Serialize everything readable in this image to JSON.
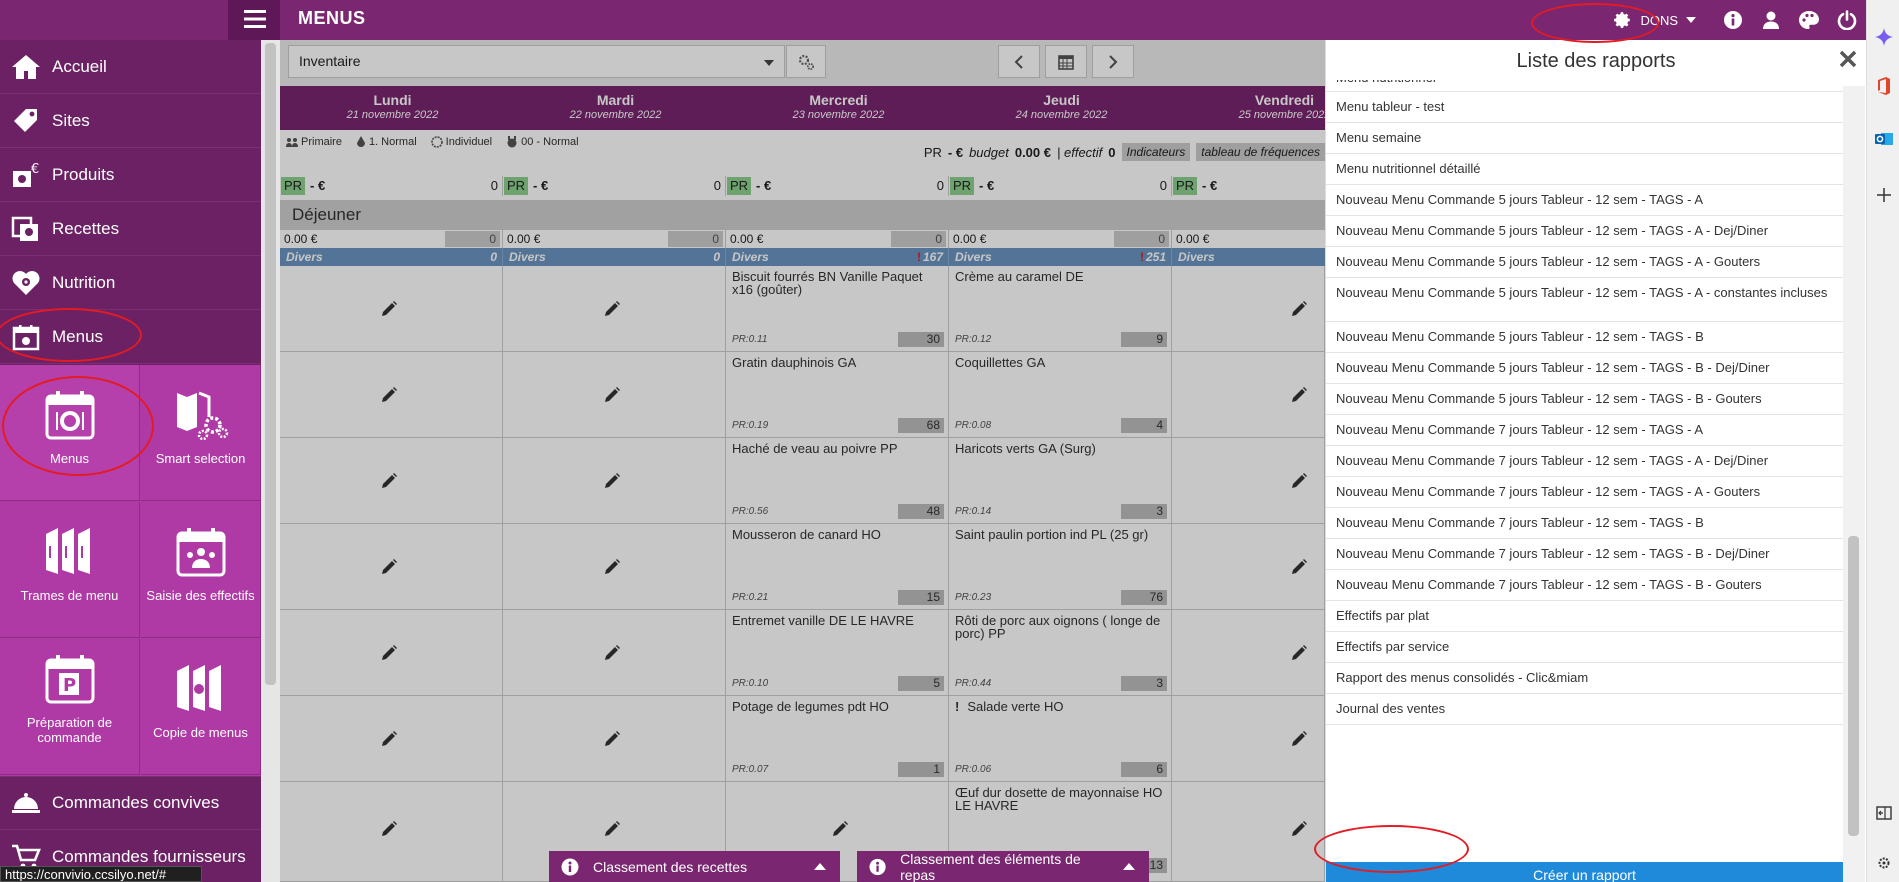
{
  "app": {
    "title": "MENUS"
  },
  "topbar": {
    "dons_label": "DONS"
  },
  "sidebar": {
    "items": [
      {
        "label": "Accueil",
        "icon": "home-icon"
      },
      {
        "label": "Sites",
        "icon": "tag-icon"
      },
      {
        "label": "Produits",
        "icon": "products-icon"
      },
      {
        "label": "Recettes",
        "icon": "recipes-icon"
      },
      {
        "label": "Nutrition",
        "icon": "nutrition-icon"
      },
      {
        "label": "Menus",
        "icon": "calendar-icon"
      }
    ],
    "tiles": [
      {
        "label": "Menus"
      },
      {
        "label": "Smart selection"
      },
      {
        "label": "Trames de menu"
      },
      {
        "label": "Saisie des effectifs"
      },
      {
        "label": "Préparation de commande"
      },
      {
        "label": "Copie de menus"
      }
    ],
    "bottom_items": [
      {
        "label": "Commandes convives"
      },
      {
        "label": "Commandes fournisseurs"
      }
    ]
  },
  "status_url": "https://convivio.ccsilyo.net/#",
  "toolbar": {
    "select_value": "Inventaire"
  },
  "days": [
    {
      "name": "Lundi",
      "date": "21 novembre 2022"
    },
    {
      "name": "Mardi",
      "date": "22 novembre 2022"
    },
    {
      "name": "Mercredi",
      "date": "23 novembre 2022"
    },
    {
      "name": "Jeudi",
      "date": "24 novembre 2022"
    },
    {
      "name": "Vendredi",
      "date": "25 novembre 2022"
    }
  ],
  "pills": [
    "Primaire",
    "1. Normal",
    "Individuel",
    "00 - Normal"
  ],
  "summary": {
    "pr_label": "PR",
    "pr_value": "- €",
    "budget_label": "budget",
    "budget_value": "0.00 €",
    "effectif_label": "| effectif",
    "effectif_value": "0",
    "btn_indicateurs": "Indicateurs",
    "btn_frequences": "tableau de fréquences"
  },
  "pr_row": [
    {
      "label": "PR",
      "euro": "- €",
      "value": "0"
    },
    {
      "label": "PR",
      "euro": "- €",
      "value": "0"
    },
    {
      "label": "PR",
      "euro": "- €",
      "value": "0"
    },
    {
      "label": "PR",
      "euro": "- €",
      "value": "0"
    },
    {
      "label": "PR",
      "euro": "- €",
      "value": ""
    }
  ],
  "section_title": "Déjeuner",
  "amount_row": [
    {
      "amount": "0.00 €",
      "value": "0"
    },
    {
      "amount": "0.00 €",
      "value": "0"
    },
    {
      "amount": "0.00 €",
      "value": "0"
    },
    {
      "amount": "0.00 €",
      "value": "0"
    },
    {
      "amount": "0.00 €",
      "value": ""
    }
  ],
  "divers_row": [
    {
      "label": "Divers",
      "value": "0",
      "alert": ""
    },
    {
      "label": "Divers",
      "value": "0",
      "alert": ""
    },
    {
      "label": "Divers",
      "value": "167",
      "alert": "!"
    },
    {
      "label": "Divers",
      "value": "251",
      "alert": "!"
    },
    {
      "label": "Divers",
      "value": "",
      "alert": ""
    }
  ],
  "dishes": {
    "mercredi": [
      {
        "name": "Biscuit fourrés BN Vanille Paquet x16 (goûter)",
        "pr": "PR:0.11",
        "qty": "30"
      },
      {
        "name": "Gratin dauphinois GA",
        "pr": "PR:0.19",
        "qty": "68"
      },
      {
        "name": "Haché de veau au poivre PP",
        "pr": "PR:0.56",
        "qty": "48"
      },
      {
        "name": "Mousseron de canard HO",
        "pr": "PR:0.21",
        "qty": "15"
      },
      {
        "name": "Entremet vanille DE LE HAVRE",
        "pr": "PR:0.10",
        "qty": "5"
      },
      {
        "name": "Potage de legumes pdt HO",
        "pr": "PR:0.07",
        "qty": "1"
      }
    ],
    "jeudi": [
      {
        "name": "Crème au caramel DE",
        "pr": "PR:0.12",
        "qty": "9"
      },
      {
        "name": "Coquillettes GA",
        "pr": "PR:0.08",
        "qty": "4"
      },
      {
        "name": "Haricots verts GA (Surg)",
        "pr": "PR:0.14",
        "qty": "3"
      },
      {
        "name": "Saint paulin portion ind PL (25 gr)",
        "pr": "PR:0.23",
        "qty": "76"
      },
      {
        "name": "Rôti de porc aux oignons ( longe de porc) PP",
        "pr": "PR:0.44",
        "qty": "3"
      },
      {
        "name": "Salade verte HO",
        "pr": "PR:0.06",
        "qty": "6",
        "alert": "!"
      },
      {
        "name": "Œuf dur dosette de mayonnaise HO LE HAVRE",
        "pr": "",
        "qty": "13"
      }
    ]
  },
  "bottom_tabs": [
    "Classement des recettes",
    "Classement des éléments de repas"
  ],
  "reports": {
    "title": "Liste des rapports",
    "create_label": "Créer un rapport",
    "items": [
      "Menu nutritionnel",
      "Menu tableur - test",
      "Menu semaine",
      "Menu nutritionnel détaillé",
      "Nouveau Menu Commande 5 jours Tableur - 12 sem - TAGS - A",
      "Nouveau Menu Commande 5 jours Tableur - 12 sem - TAGS - A - Dej/Diner",
      "Nouveau Menu Commande 5 jours Tableur - 12 sem - TAGS - A - Gouters",
      "Nouveau Menu Commande 5 jours Tableur - 12 sem - TAGS - A - constantes incluses",
      "Nouveau Menu Commande 5 jours Tableur - 12 sem - TAGS - B",
      "Nouveau Menu Commande 5 jours Tableur - 12 sem - TAGS - B - Dej/Diner",
      "Nouveau Menu Commande 5 jours Tableur - 12 sem - TAGS - B - Gouters",
      "Nouveau Menu Commande 7 jours Tableur - 12 sem - TAGS - A",
      "Nouveau Menu Commande 7 jours Tableur - 12 sem - TAGS - A - Dej/Diner",
      "Nouveau Menu Commande 7 jours Tableur - 12 sem - TAGS - A - Gouters",
      "Nouveau Menu Commande 7 jours Tableur - 12 sem - TAGS - B",
      "Nouveau Menu Commande 7 jours Tableur - 12 sem - TAGS - B - Dej/Diner",
      "Nouveau Menu Commande 7 jours Tableur - 12 sem - TAGS - B - Gouters",
      "Effectifs par plat",
      "Effectifs par service",
      "Rapport des menus consolidés - Clic&miam",
      "Journal des ventes"
    ]
  },
  "colors": {
    "brand": "#7a2670",
    "sidebar": "#6b2163",
    "tile": "#b03aa5",
    "annotation": "#e31b23",
    "divers": "#6b95c0",
    "pr_badge": "#8ed08e"
  }
}
